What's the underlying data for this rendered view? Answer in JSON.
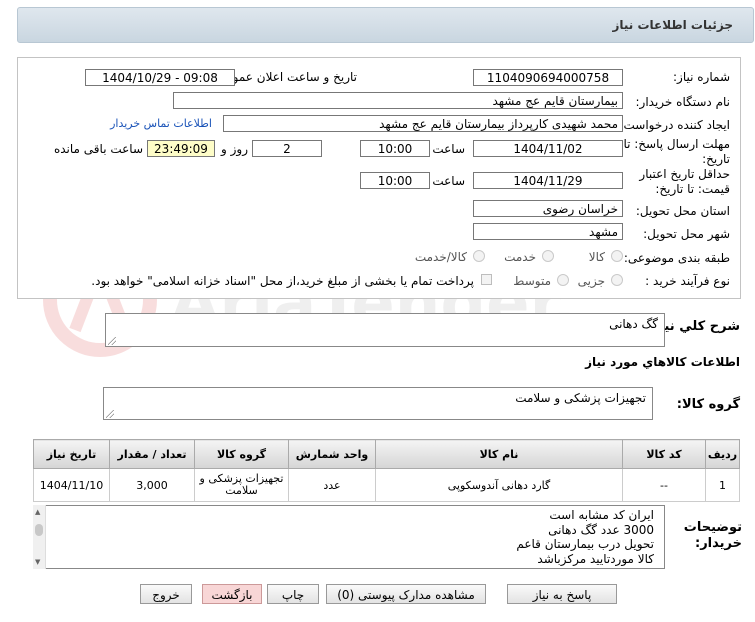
{
  "header": {
    "title": "جزئیات اطلاعات نیاز"
  },
  "watermark": {
    "text": "AriaTender.neT"
  },
  "form": {
    "need_number_label": "شماره نیاز:",
    "need_number": "1104090694000758",
    "announce_label": "تاریخ و ساعت اعلان عمومی:",
    "announce_value": "1404/10/29 - 09:08",
    "buyer_label": "نام دستگاه خریدار:",
    "buyer_value": "بیمارستان قایم  عج  مشهد",
    "creator_label": "ایجاد کننده درخواست:",
    "creator_value": "محمد شهیدی کارپرداز بیمارستان قایم  عج  مشهد",
    "contact_link": "اطلاعات تماس خریدار",
    "deadline_label_1": "مهلت ارسال پاسخ: تا",
    "deadline_label_2": "تاریخ:",
    "deadline_date": "1404/11/02",
    "time_label": "ساعت",
    "deadline_time": "10:00",
    "days_value": "2",
    "days_label": "روز و",
    "remaining_value": "23:49:09",
    "remaining_label": "ساعت باقی مانده",
    "validity_label_1": "حداقل تاریخ اعتبار",
    "validity_label_2": "قیمت: تا تاریخ:",
    "validity_date": "1404/11/29",
    "validity_time": "10:00",
    "province_label": "استان محل تحویل:",
    "province_value": "خراسان رضوی",
    "city_label": "شهر محل تحویل:",
    "city_value": "مشهد",
    "category_label": "طبقه بندی موضوعی:",
    "category_options": [
      "کالا",
      "خدمت",
      "کالا/خدمت"
    ],
    "process_label": "نوع فرآیند خرید :",
    "process_options": [
      "جزیی",
      "متوسط"
    ],
    "payment_note": "پرداخت تمام یا بخشی از مبلغ خرید،از محل \"اسناد خزانه اسلامی\" خواهد بود."
  },
  "summary": {
    "label": "شرح کلي نياز:",
    "value": "گگ دهانی"
  },
  "goods_info": {
    "title": "اطلاعات کالاهاي مورد نياز",
    "group_label": "گروه کالا:",
    "group_value": "تجهیزات پزشکی و سلامت"
  },
  "table": {
    "headers": [
      "ردیف",
      "کد کالا",
      "نام کالا",
      "واحد شمارش",
      "گروه کالا",
      "تعداد / مقدار",
      "تاریخ نیاز"
    ],
    "rows": [
      [
        "1",
        "--",
        "گارد دهانی آندوسکوپی",
        "عدد",
        "تجهیزات پزشکی و سلامت",
        "3,000",
        "1404/11/10"
      ]
    ]
  },
  "buyer_notes": {
    "label_1": "توضیحات",
    "label_2": "خریدار:",
    "lines": [
      "ایران  کد مشابه است",
      "3000 عدد گگ دهانی",
      "تحویل درب بیمارستان قاعم",
      "کالا  موردتایید مرکزباشد"
    ]
  },
  "buttons": {
    "reply": "پاسخ به نیاز",
    "docs": "مشاهده مدارک پیوستی (0)",
    "print": "چاپ",
    "back": "بازگشت",
    "exit": "خروج"
  }
}
